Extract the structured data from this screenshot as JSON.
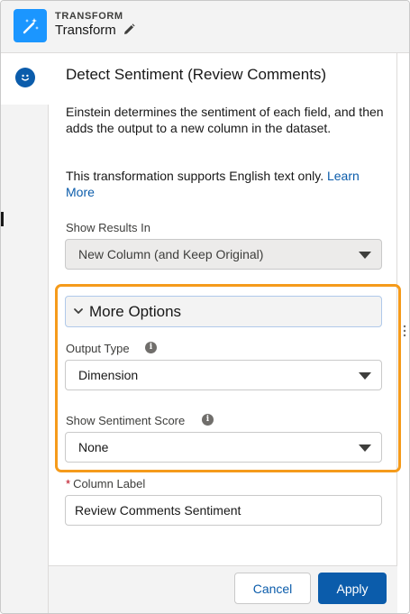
{
  "header": {
    "label": "TRANSFORM",
    "title": "Transform",
    "icon": "magic-wand-icon",
    "edit_icon": "pencil-icon",
    "accent": "#1b96ff"
  },
  "rail": {
    "active_icon": "smiley-icon"
  },
  "panel": {
    "title": "Detect Sentiment (Review Comments)",
    "description": "Einstein determines the sentiment of each field, and then adds the output to a new column in the dataset.",
    "note": "This transformation supports English text only.",
    "learn_more": "Learn More"
  },
  "fields": {
    "show_results_in": {
      "label": "Show Results In",
      "value": "New Column (and Keep Original)"
    },
    "more_options": {
      "label": "More Options",
      "expanded": true
    },
    "output_type": {
      "label": "Output Type",
      "value": "Dimension"
    },
    "sentiment_score": {
      "label": "Show Sentiment Score",
      "value": "None"
    },
    "column_label": {
      "required_mark": "*",
      "label": "Column Label",
      "value": "Review Comments Sentiment"
    }
  },
  "footer": {
    "cancel": "Cancel",
    "apply": "Apply"
  },
  "colors": {
    "brand": "#0b5cab",
    "highlight": "#f59b1b"
  }
}
